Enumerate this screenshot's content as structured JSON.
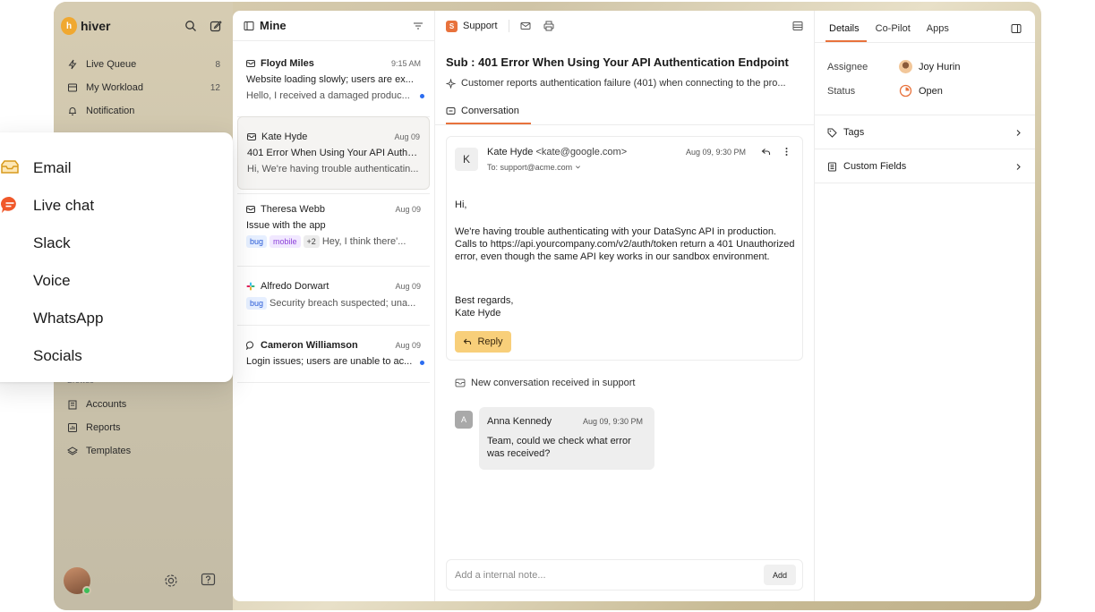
{
  "app": {
    "logo": "hiver",
    "logo_mark": "h"
  },
  "sidebar": {
    "nav": [
      {
        "label": "Live Queue",
        "count": "8",
        "icon": "bolt-icon"
      },
      {
        "label": "My Workload",
        "count": "12",
        "icon": "inbox-icon"
      },
      {
        "label": "Notification",
        "count": "",
        "icon": "bell-icon"
      }
    ],
    "browse_label": "Browse",
    "browse": [
      {
        "label": "Accounts",
        "icon": "building-icon"
      },
      {
        "label": "Reports",
        "icon": "chart-icon"
      },
      {
        "label": "Templates",
        "icon": "layers-icon"
      }
    ]
  },
  "channel_menu": {
    "items": [
      {
        "label": "Email",
        "icon": "email-tray-icon"
      },
      {
        "label": "Live chat",
        "icon": "chat-bubble-icon"
      },
      {
        "label": "Slack",
        "icon": ""
      },
      {
        "label": "Voice",
        "icon": ""
      },
      {
        "label": "WhatsApp",
        "icon": ""
      },
      {
        "label": "Socials",
        "icon": ""
      }
    ]
  },
  "mine": {
    "title": "Mine",
    "conversations": [
      {
        "name": "Floyd Miles",
        "date": "9:15 AM",
        "subject": "Website loading slowly; users are ex...",
        "preview": "Hello, I received a damaged produc...",
        "unread": true,
        "channel": "email"
      },
      {
        "name": "Kate Hyde",
        "date": "Aug 09",
        "subject": "401 Error When Using Your API Authe...",
        "preview": "Hi, We're having trouble authenticatin...",
        "unread": false,
        "channel": "email",
        "selected": true
      },
      {
        "name": "Theresa Webb",
        "date": "Aug 09",
        "subject": "Issue with the app",
        "tags": [
          "bug",
          "mobile",
          "+2"
        ],
        "preview": "Hey, I think there'...",
        "channel": "email"
      },
      {
        "name": "Alfredo Dorwart",
        "date": "Aug 09",
        "tags": [
          "bug"
        ],
        "preview": "Security breach suspected; una...",
        "channel": "slack"
      },
      {
        "name": "Cameron Williamson",
        "date": "Aug 09",
        "subject": "Login issues; users are unable to ac...",
        "unread": true,
        "channel": "chat"
      }
    ]
  },
  "thread": {
    "inbox": "Support",
    "inbox_badge": "S",
    "subject": "Sub : 401 Error When Using Your API Authentication Endpoint",
    "summary": "Customer reports authentication failure (401) when connecting to the pro...",
    "tab": "Conversation",
    "message": {
      "avatar": "K",
      "from_name": "Kate Hyde",
      "from_email": "<kate@google.com>",
      "to": "To: support@acme.com",
      "date": "Aug 09, 9:30 PM",
      "greeting": "Hi,",
      "body": "We're having trouble authenticating with your DataSync API in production. Calls to https://api.yourcompany.com/v2/auth/token return a 401 Unauthorized error, even though the same API key works in our sandbox environment.",
      "signoff": "Best regards,",
      "signature": "Kate Hyde",
      "reply_label": "Reply"
    },
    "event": "New conversation received in support",
    "note": {
      "avatar": "A",
      "author": "Anna Kennedy",
      "date": "Aug 09, 9:30 PM",
      "text": "Team, could we check what error was received?"
    },
    "note_input": {
      "placeholder": "Add a internal note...",
      "add_label": "Add"
    }
  },
  "details": {
    "tabs": [
      "Details",
      "Co-Pilot",
      "Apps"
    ],
    "assignee_label": "Assignee",
    "assignee": "Joy Hurin",
    "status_label": "Status",
    "status": "Open",
    "tags_label": "Tags",
    "custom_fields_label": "Custom Fields",
    "accent": "#e8723c"
  }
}
